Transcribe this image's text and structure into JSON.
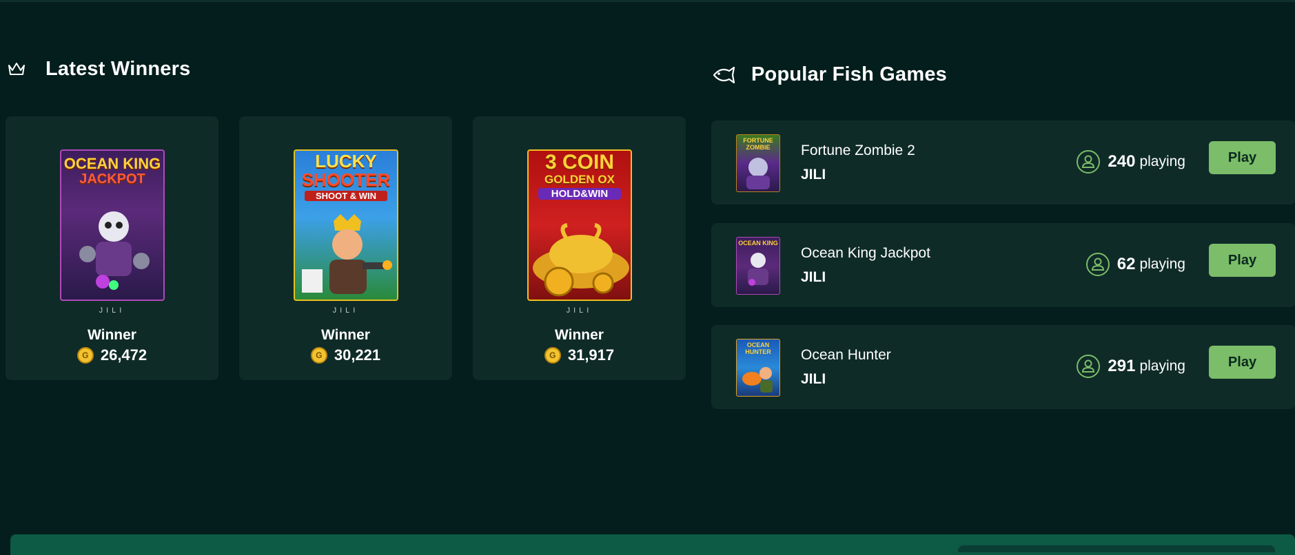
{
  "latest_winners": {
    "title": "Latest Winners",
    "icon": "crown-icon",
    "cards": [
      {
        "game": "Ocean King Jackpot",
        "art_line1": "OCEAN KING",
        "art_line2": "JACKPOT",
        "provider": "JILI",
        "label": "Winner",
        "amount": "26,472",
        "coin_glyph": "G"
      },
      {
        "game": "Lucky Shooter",
        "art_line1": "LUCKY",
        "art_line2": "SHOOTER",
        "art_line3": "SHOOT & WIN",
        "provider": "JILI",
        "label": "Winner",
        "amount": "30,221",
        "coin_glyph": "G"
      },
      {
        "game": "3 Coin Golden Ox",
        "art_line1": "3 COIN",
        "art_line2": "GOLDEN OX",
        "art_line3": "HOLD&WIN",
        "provider": "JILI",
        "label": "Winner",
        "amount": "31,917",
        "coin_glyph": "G"
      }
    ]
  },
  "popular_fish_games": {
    "title": "Popular Fish Games",
    "icon": "fish-icon",
    "games": [
      {
        "name": "Fortune Zombie 2",
        "provider": "JILI",
        "playing_count": "240",
        "playing_label": "playing",
        "play_label": "Play",
        "art": "FORTUNE ZOMBIE"
      },
      {
        "name": "Ocean King Jackpot",
        "provider": "JILI",
        "playing_count": "62",
        "playing_label": "playing",
        "play_label": "Play",
        "art": "OCEAN KING"
      },
      {
        "name": "Ocean Hunter",
        "provider": "JILI",
        "playing_count": "291",
        "playing_label": "playing",
        "play_label": "Play",
        "art": "OCEAN HUNTER"
      }
    ]
  },
  "colors": {
    "background": "#031e1c",
    "card": "#0f2b28",
    "play_button": "#7bbd68",
    "accent_green_icon": "#7bbd68",
    "coin": "#f2c230"
  }
}
